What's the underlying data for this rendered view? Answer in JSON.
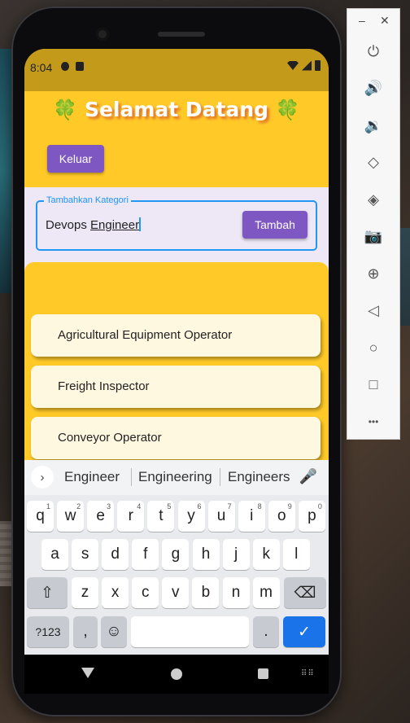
{
  "status_bar": {
    "time": "8:04"
  },
  "app": {
    "title": "Selamat Datang",
    "clover_glyph": "🍀",
    "logout_label": "Keluar",
    "input": {
      "label": "Tambahkan Kategori",
      "value_prefix": "Devops ",
      "value_underlined": "Engineer"
    },
    "add_label": "Tambah",
    "categories": [
      "Agricultural Equipment Operator",
      "Freight Inspector",
      "Conveyor Operator"
    ]
  },
  "keyboard": {
    "suggestions": [
      "Engineer",
      "Engineering",
      "Engineers"
    ],
    "row1": [
      {
        "k": "q",
        "n": "1"
      },
      {
        "k": "w",
        "n": "2"
      },
      {
        "k": "e",
        "n": "3"
      },
      {
        "k": "r",
        "n": "4"
      },
      {
        "k": "t",
        "n": "5"
      },
      {
        "k": "y",
        "n": "6"
      },
      {
        "k": "u",
        "n": "7"
      },
      {
        "k": "i",
        "n": "8"
      },
      {
        "k": "o",
        "n": "9"
      },
      {
        "k": "p",
        "n": "0"
      }
    ],
    "row2": [
      "a",
      "s",
      "d",
      "f",
      "g",
      "h",
      "j",
      "k",
      "l"
    ],
    "row3": [
      "z",
      "x",
      "c",
      "v",
      "b",
      "n",
      "m"
    ],
    "symbols_label": "?123",
    "comma_label": ",",
    "period_label": "."
  },
  "icons": {
    "suggest_expand": "chevron-right-icon",
    "mic": "microphone-icon",
    "shift": "shift-icon",
    "backspace": "backspace-icon",
    "emoji": "emoji-icon",
    "enter": "checkmark-icon"
  },
  "emulator_panel": {
    "items": [
      "power-icon",
      "volume-up-icon",
      "volume-down-icon",
      "rotate-left-icon",
      "rotate-right-icon",
      "camera-icon",
      "zoom-icon",
      "back-icon",
      "home-icon",
      "overview-icon",
      "more-icon"
    ]
  },
  "colors": {
    "accent": "#7e57c2",
    "header": "#ffca28",
    "focus": "#2196f3",
    "card": "#fff8e1"
  }
}
